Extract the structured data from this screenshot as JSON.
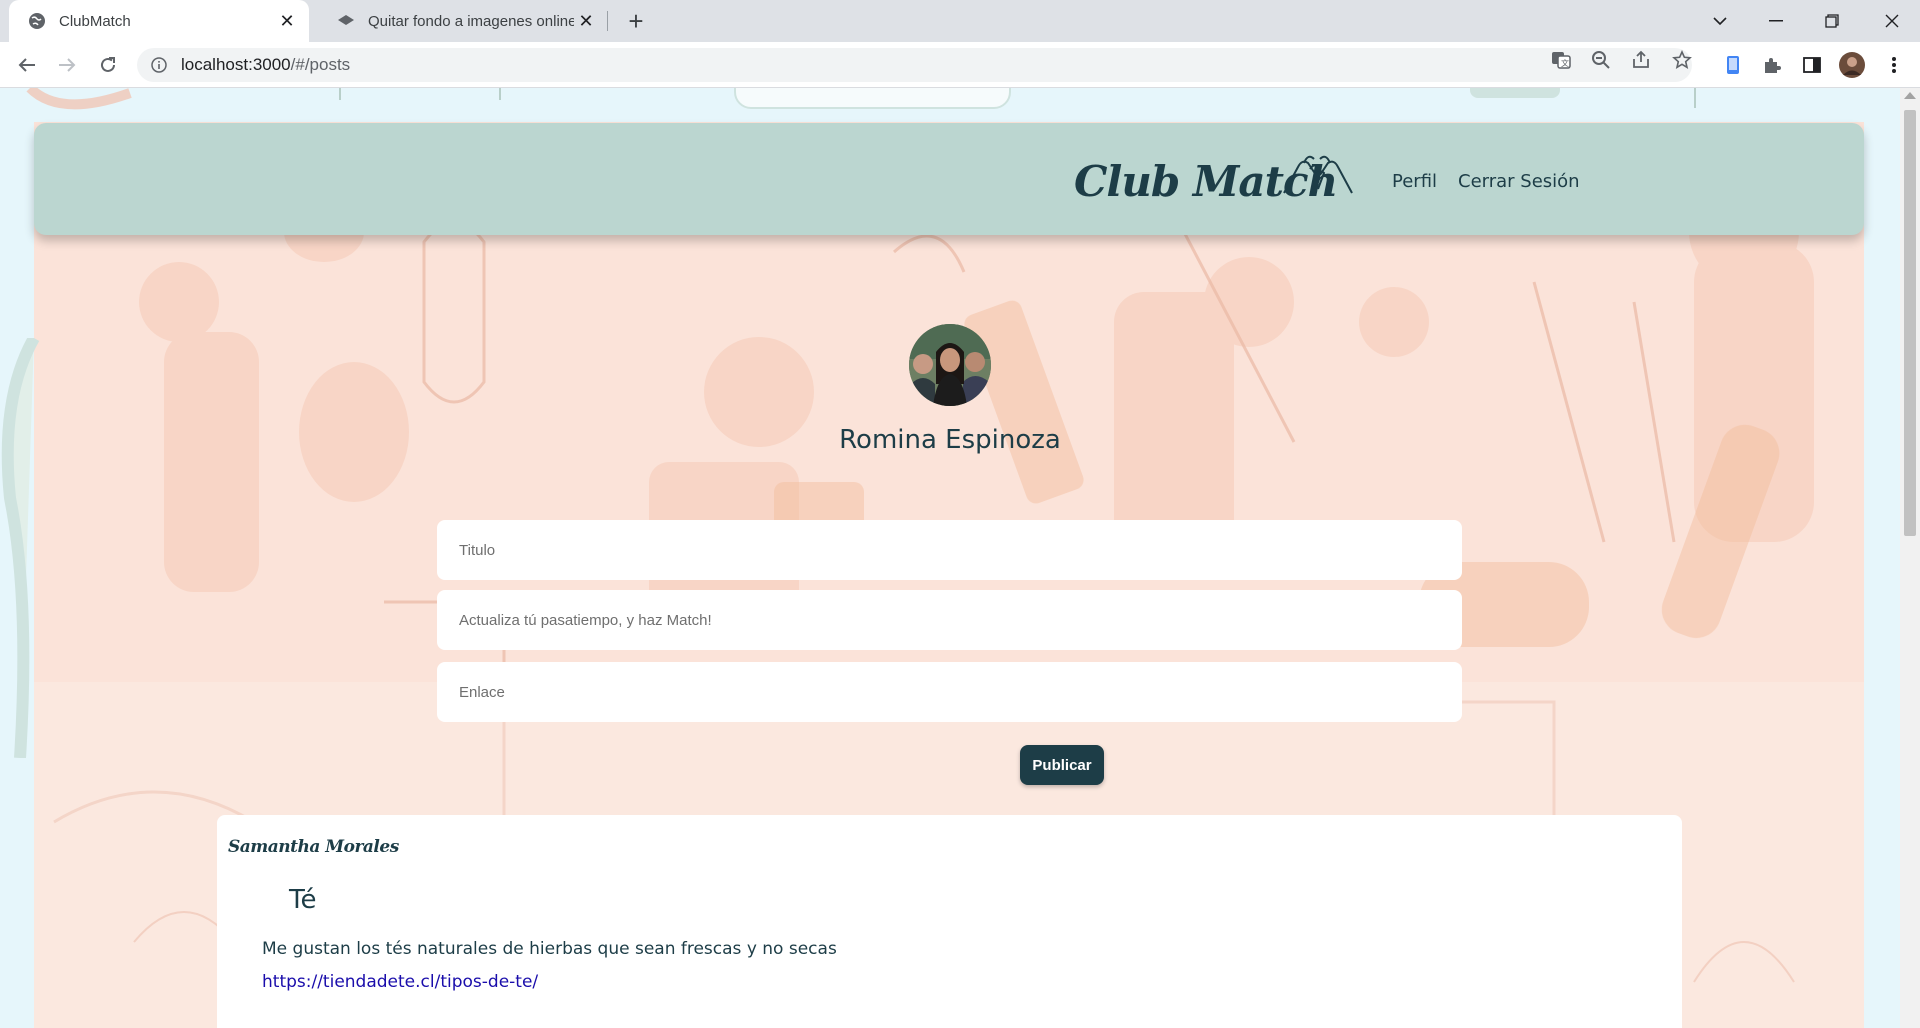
{
  "browser": {
    "tabs": [
      {
        "title": "ClubMatch",
        "active": true
      },
      {
        "title": "Quitar fondo a imagenes online y",
        "active": false
      }
    ],
    "url_host": "localhost:3000",
    "url_path": "/#/posts"
  },
  "header": {
    "brand": "Club Match",
    "nav": [
      "Perfil",
      "Cerrar Sesión"
    ]
  },
  "profile": {
    "name": "Romina Espinoza"
  },
  "form": {
    "title_placeholder": "Titulo",
    "description_placeholder": "Actualiza tú pasatiempo, y haz Match!",
    "link_placeholder": "Enlace",
    "submit_label": "Publicar"
  },
  "posts": [
    {
      "author": "Samantha Morales",
      "title": "Té",
      "description": "Me gustan los tés naturales de hierbas que sean frescas y no secas",
      "link": "https://tiendadete.cl/tipos-de-te/"
    }
  ],
  "colors": {
    "accent": "#1d3d47",
    "header_bg": "#bbd6d0",
    "page_bg": "#fbe3d9"
  }
}
